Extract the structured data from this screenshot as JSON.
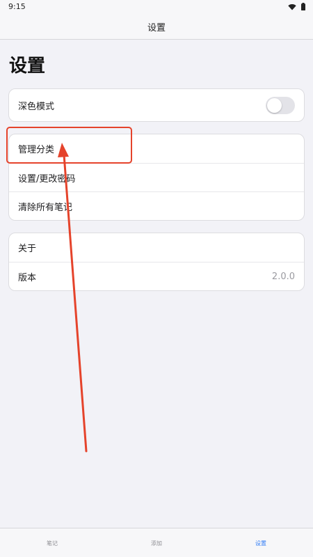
{
  "status_bar": {
    "time": "9:15",
    "icons": [
      "wifi-icon",
      "battery-icon"
    ]
  },
  "nav": {
    "title": "设置"
  },
  "page": {
    "title": "设置"
  },
  "groups": {
    "display": {
      "dark_mode_label": "深色模式",
      "dark_mode_enabled": false
    },
    "manage": {
      "items": [
        "管理分类",
        "设置/更改密码",
        "清除所有笔记"
      ]
    },
    "about": {
      "about_label": "关于",
      "version_label": "版本",
      "version_value": "2.0.0"
    }
  },
  "tabs": [
    {
      "label": "笔记",
      "active": false
    },
    {
      "label": "添加",
      "active": false
    },
    {
      "label": "设置",
      "active": true
    }
  ],
  "colors": {
    "accent": "#2f7bf5",
    "annotation": "#e5432b",
    "background": "#f2f2f7"
  }
}
